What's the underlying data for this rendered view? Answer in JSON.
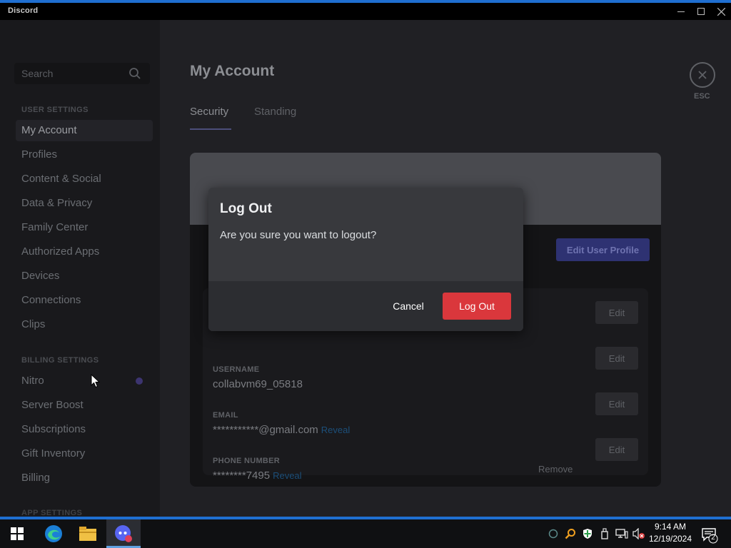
{
  "window": {
    "title": "Discord",
    "controls": {
      "minimize": "minimize",
      "maximize": "maximize",
      "close": "close"
    }
  },
  "sidebar": {
    "search_placeholder": "Search",
    "user_settings_header": "USER SETTINGS",
    "user_items": [
      {
        "label": "My Account",
        "active": true
      },
      {
        "label": "Profiles"
      },
      {
        "label": "Content & Social"
      },
      {
        "label": "Data & Privacy"
      },
      {
        "label": "Family Center"
      },
      {
        "label": "Authorized Apps"
      },
      {
        "label": "Devices"
      },
      {
        "label": "Connections"
      },
      {
        "label": "Clips"
      }
    ],
    "billing_settings_header": "BILLING SETTINGS",
    "billing_items": [
      {
        "label": "Nitro"
      },
      {
        "label": "Server Boost"
      },
      {
        "label": "Subscriptions"
      },
      {
        "label": "Gift Inventory"
      },
      {
        "label": "Billing"
      }
    ],
    "app_settings_header": "APP SETTINGS"
  },
  "main": {
    "title": "My Account",
    "tabs": [
      {
        "label": "Security",
        "active": true
      },
      {
        "label": "Standing"
      }
    ],
    "esc_label": "ESC",
    "edit_profile_label": "Edit User Profile",
    "fields": {
      "username": {
        "label": "USERNAME",
        "value": "collabvm69_05818",
        "edit": "Edit"
      },
      "email": {
        "label": "EMAIL",
        "value": "***********@gmail.com",
        "reveal": "Reveal",
        "edit": "Edit"
      },
      "phone": {
        "label": "PHONE NUMBER",
        "value": "********7495",
        "reveal": "Reveal",
        "remove": "Remove",
        "edit": "Edit"
      },
      "display_name_edit": "Edit"
    }
  },
  "modal": {
    "title": "Log Out",
    "body": "Are you sure you want to logout?",
    "cancel_label": "Cancel",
    "confirm_label": "Log Out"
  },
  "taskbar": {
    "time": "9:14 AM",
    "date": "12/19/2024",
    "notification_count": "2"
  },
  "colors": {
    "accent_blue": "#1f6fd1",
    "danger_red": "#da373c",
    "blurple_dim": "#2e3272"
  }
}
